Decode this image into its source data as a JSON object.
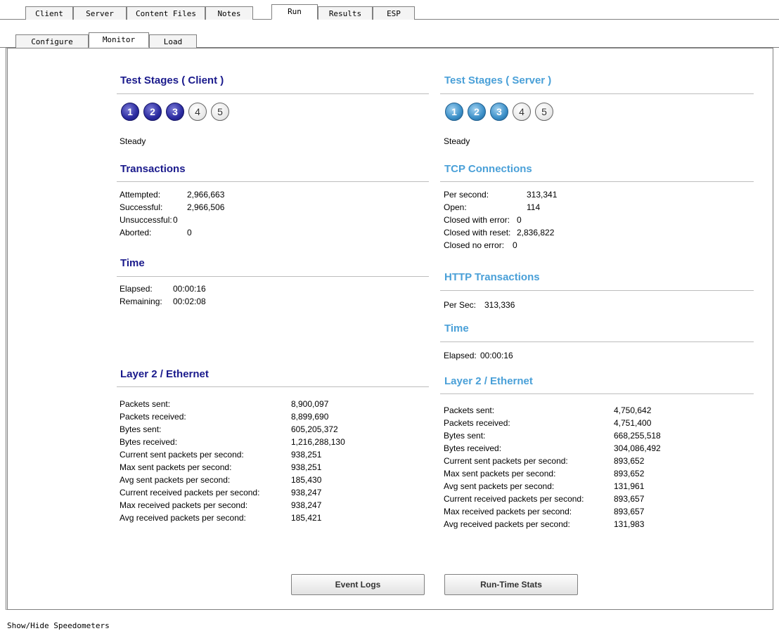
{
  "top_tabs": [
    {
      "label": "Client",
      "active": false
    },
    {
      "label": "Server",
      "active": false
    },
    {
      "label": "Content Files",
      "active": false
    },
    {
      "label": "Notes",
      "active": false
    },
    {
      "label": "Run",
      "active": true
    },
    {
      "label": "Results",
      "active": false
    },
    {
      "label": "ESP",
      "active": false
    }
  ],
  "sub_tabs": [
    {
      "label": "Configure",
      "active": false
    },
    {
      "label": "Monitor",
      "active": true
    },
    {
      "label": "Load",
      "active": false
    }
  ],
  "client": {
    "stages_title": "Test Stages ( Client )",
    "stages": [
      {
        "n": "1",
        "state": "done"
      },
      {
        "n": "2",
        "state": "done"
      },
      {
        "n": "3",
        "state": "done"
      },
      {
        "n": "4",
        "state": "todo"
      },
      {
        "n": "5",
        "state": "todo"
      }
    ],
    "status": "Steady",
    "transactions_title": "Transactions",
    "transactions": [
      {
        "label": "Attempted:",
        "value": "2,966,663"
      },
      {
        "label": "Successful:",
        "value": "2,966,506"
      },
      {
        "label": "Unsuccessful:",
        "value": "0"
      },
      {
        "label": "Aborted:",
        "value": "0"
      }
    ],
    "time_title": "Time",
    "time": [
      {
        "label": "Elapsed:",
        "value": "00:00:16"
      },
      {
        "label": "Remaining:",
        "value": "00:02:08"
      }
    ],
    "layer2_title": "Layer 2 / Ethernet",
    "layer2": [
      {
        "label": "Packets sent:",
        "value": "8,900,097"
      },
      {
        "label": "Packets received:",
        "value": "8,899,690"
      },
      {
        "label": "Bytes sent:",
        "value": "605,205,372"
      },
      {
        "label": "Bytes received:",
        "value": "1,216,288,130"
      },
      {
        "label": "Current sent packets per second:",
        "value": "938,251"
      },
      {
        "label": "Max sent packets per second:",
        "value": "938,251"
      },
      {
        "label": "Avg sent packets per second:",
        "value": "185,430"
      },
      {
        "label": "Current received packets per second:",
        "value": "938,247"
      },
      {
        "label": "Max received packets per second:",
        "value": "938,247"
      },
      {
        "label": "Avg received packets per second:",
        "value": "185,421"
      }
    ]
  },
  "server": {
    "stages_title": "Test Stages ( Server )",
    "stages": [
      {
        "n": "1",
        "state": "done"
      },
      {
        "n": "2",
        "state": "done"
      },
      {
        "n": "3",
        "state": "done"
      },
      {
        "n": "4",
        "state": "todo"
      },
      {
        "n": "5",
        "state": "todo"
      }
    ],
    "status": "Steady",
    "tcp_title": "TCP Connections",
    "tcp": [
      {
        "label": "Per second:",
        "value": "313,341"
      },
      {
        "label": "Open:",
        "value": "114"
      },
      {
        "label": "Closed with error:",
        "value": "0"
      },
      {
        "label": "Closed with reset:",
        "value": "2,836,822"
      },
      {
        "label": "Closed no error:",
        "value": "0"
      }
    ],
    "http_title": "HTTP Transactions",
    "http": [
      {
        "label": "Per Sec:",
        "value": "313,336"
      }
    ],
    "time_title": "Time",
    "time": [
      {
        "label": "Elapsed:",
        "value": "00:00:16"
      }
    ],
    "layer2_title": "Layer 2 / Ethernet",
    "layer2": [
      {
        "label": "Packets sent:",
        "value": "4,750,642"
      },
      {
        "label": "Packets received:",
        "value": "4,751,400"
      },
      {
        "label": "Bytes sent:",
        "value": "668,255,518"
      },
      {
        "label": "Bytes received:",
        "value": "304,086,492"
      },
      {
        "label": "Current sent packets per second:",
        "value": "893,652"
      },
      {
        "label": "Max sent packets per second:",
        "value": "893,652"
      },
      {
        "label": "Avg sent packets per second:",
        "value": "131,961"
      },
      {
        "label": "Current received packets per second:",
        "value": "893,657"
      },
      {
        "label": "Max received packets per second:",
        "value": "893,657"
      },
      {
        "label": "Avg received packets per second:",
        "value": "131,983"
      }
    ]
  },
  "buttons": {
    "event_logs": "Event Logs",
    "runtime_stats": "Run-Time Stats"
  },
  "status_bar": "Show/Hide Speedometers"
}
